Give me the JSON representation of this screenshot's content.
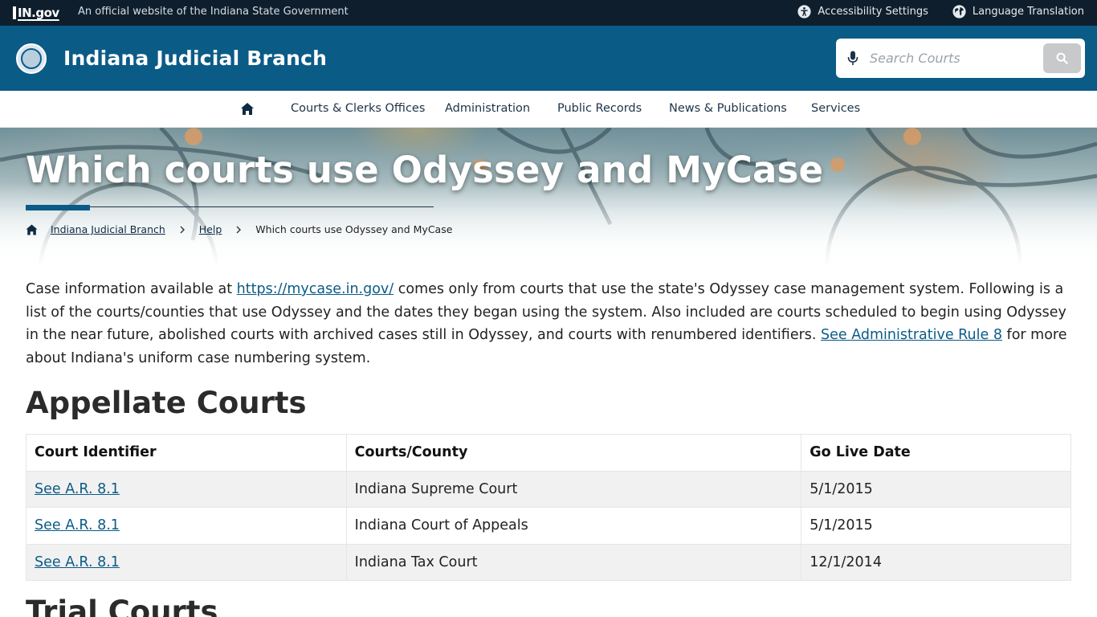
{
  "gov_bar": {
    "logo_text": "IN.gov",
    "tagline": "An official website of the Indiana State Government",
    "accessibility_label": "Accessibility Settings",
    "translation_label": "Language Translation"
  },
  "header": {
    "site_title": "Indiana Judicial Branch",
    "search_placeholder": "Search Courts"
  },
  "nav": {
    "items": [
      {
        "label": "Courts & Clerks Offices"
      },
      {
        "label": "Administration"
      },
      {
        "label": "Public Records"
      },
      {
        "label": "News & Publications"
      },
      {
        "label": "Services"
      }
    ]
  },
  "hero": {
    "title": "Which courts use Odyssey and MyCase",
    "breadcrumb": {
      "items": [
        "Indiana Judicial Branch",
        "Help"
      ],
      "current": "Which courts use Odyssey and MyCase"
    }
  },
  "intro": {
    "text_1": "Case information available at ",
    "link_1": "https://mycase.in.gov/",
    "text_2": " comes only from courts that use the state's Odyssey case management system. Following is a list of the courts/counties that use Odyssey and the dates they began using the system. Also included are courts scheduled to begin using Odyssey in the near future, abolished courts with archived cases still in Odyssey, and courts with renumbered identifiers. ",
    "link_2": "See Administrative Rule 8",
    "text_3": " for more about Indiana's uniform case numbering system."
  },
  "appellate": {
    "heading": "Appellate Courts",
    "columns": [
      "Court Identifier",
      "Courts/County",
      "Go Live Date"
    ],
    "rows": [
      {
        "identifier": "See A.R. 8.1",
        "court": "Indiana Supreme Court",
        "date": "5/1/2015"
      },
      {
        "identifier": "See A.R. 8.1",
        "court": "Indiana Court of Appeals",
        "date": "5/1/2015"
      },
      {
        "identifier": "See A.R. 8.1",
        "court": "Indiana Tax Court",
        "date": "12/1/2014"
      }
    ]
  },
  "trial": {
    "heading": "Trial Courts"
  },
  "colors": {
    "header_blue": "#0b5b87",
    "gov_bar": "#0f1e2c",
    "link_blue": "#0b5b87"
  },
  "icons": {
    "accessibility": "accessibility-icon",
    "translation": "globe-icon",
    "microphone": "microphone-icon",
    "search": "search-icon",
    "home": "home-icon"
  }
}
